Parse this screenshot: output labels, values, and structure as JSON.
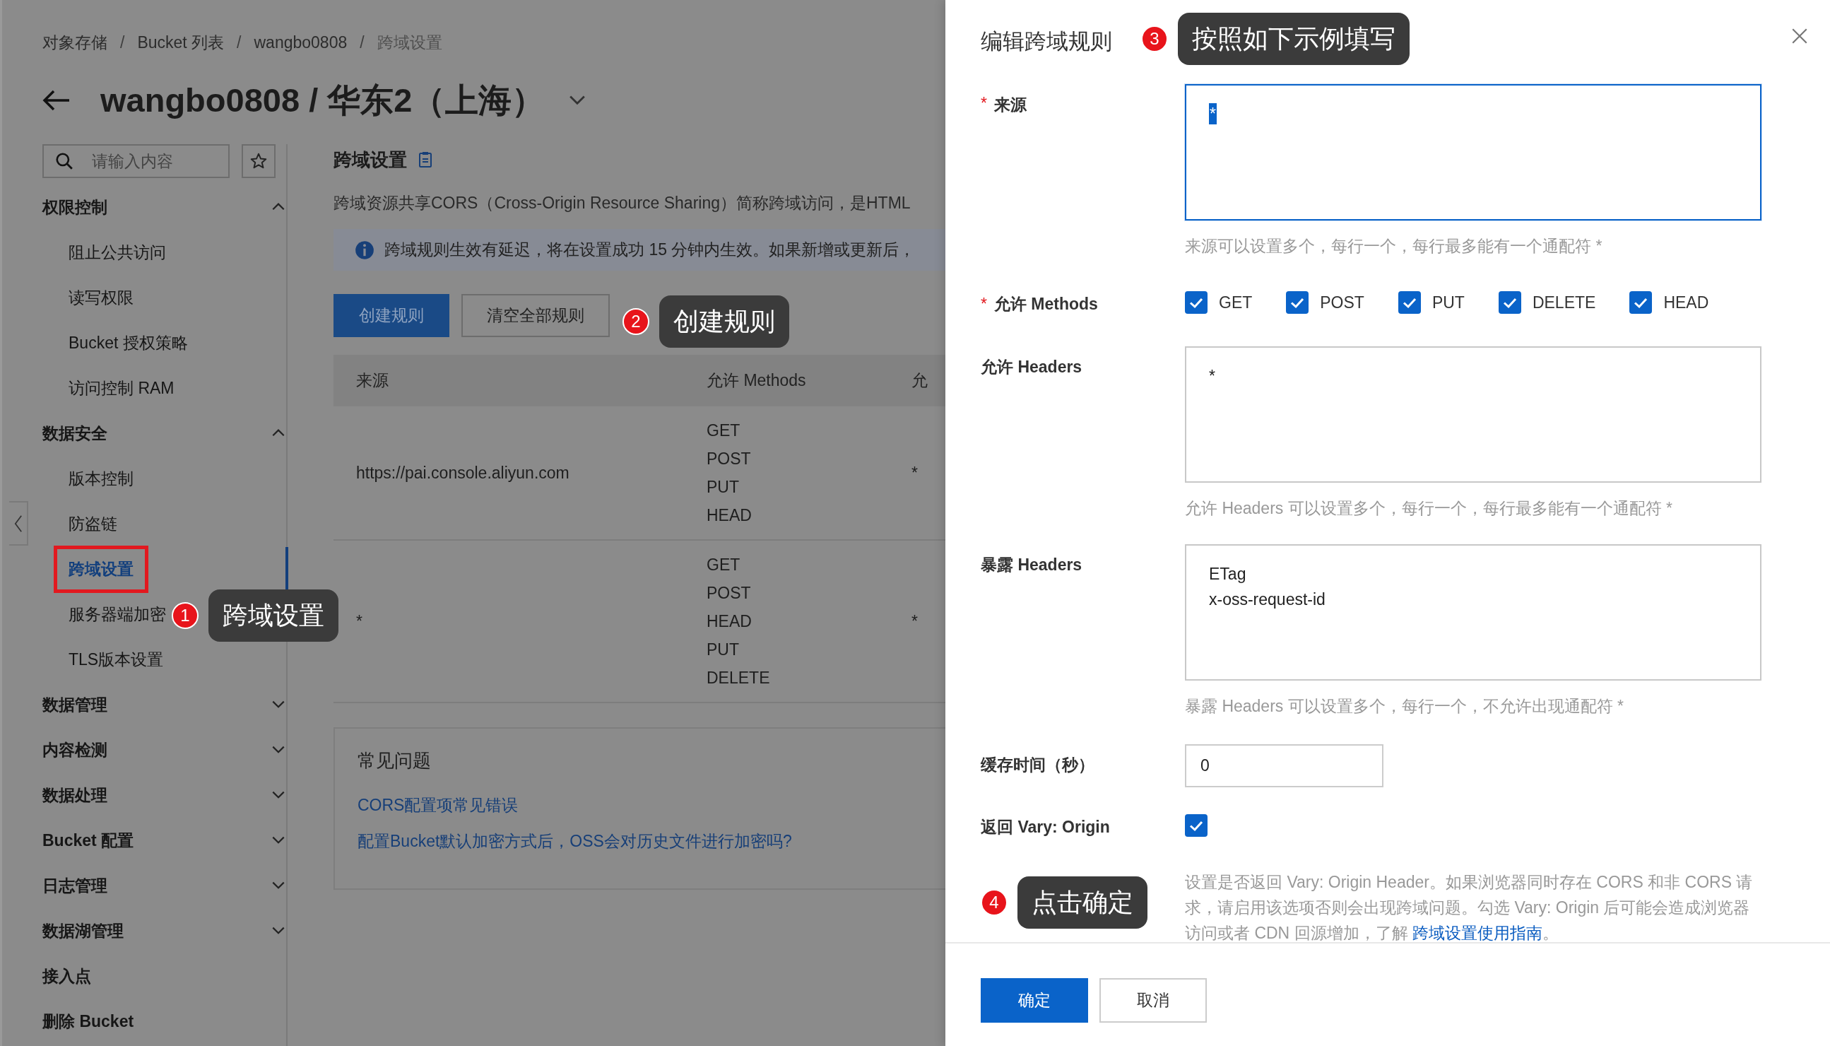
{
  "breadcrumb": {
    "separator": "/",
    "items": [
      "对象存储",
      "Bucket 列表",
      "wangbo0808",
      "跨域设置"
    ]
  },
  "page_title": "wangbo0808 / 华东2（上海）",
  "sidebar": {
    "search": {
      "placeholder": "请输入内容"
    },
    "items": [
      {
        "label": "权限控制",
        "kind": "group",
        "expanded": true,
        "children": [
          {
            "label": "阻止公共访问",
            "selected": false,
            "boxed": false
          },
          {
            "label": "读写权限",
            "selected": false,
            "boxed": false
          },
          {
            "label": "Bucket 授权策略",
            "selected": false,
            "boxed": false
          },
          {
            "label": "访问控制 RAM",
            "selected": false,
            "boxed": false
          }
        ]
      },
      {
        "label": "数据安全",
        "kind": "group",
        "expanded": true,
        "children": [
          {
            "label": "版本控制",
            "selected": false,
            "boxed": false
          },
          {
            "label": "防盗链",
            "selected": false,
            "boxed": false
          },
          {
            "label": "跨域设置",
            "selected": true,
            "boxed": true
          },
          {
            "label": "服务器端加密",
            "selected": false,
            "boxed": false
          },
          {
            "label": "TLS版本设置",
            "selected": false,
            "boxed": false
          }
        ]
      },
      {
        "label": "数据管理",
        "kind": "group",
        "expanded": false
      },
      {
        "label": "内容检测",
        "kind": "group",
        "expanded": false
      },
      {
        "label": "数据处理",
        "kind": "group",
        "expanded": false
      },
      {
        "label": "Bucket 配置",
        "kind": "group",
        "expanded": false
      },
      {
        "label": "日志管理",
        "kind": "group",
        "expanded": false
      },
      {
        "label": "数据湖管理",
        "kind": "group",
        "expanded": false
      },
      {
        "label": "接入点",
        "kind": "link"
      },
      {
        "label": "删除 Bucket",
        "kind": "link"
      }
    ]
  },
  "section": {
    "title": "跨域设置",
    "description": "跨域资源共享CORS（Cross-Origin Resource Sharing）简称跨域访问，是HTML",
    "alert": "跨域规则生效有延迟，将在设置成功 15 分钟内生效。如果新增或更新后，",
    "actions": [
      {
        "label": "创建规则",
        "kind": "primary"
      },
      {
        "label": "清空全部规则",
        "kind": "secondary"
      }
    ]
  },
  "table": {
    "columns": [
      "来源",
      "允许 Methods",
      "允"
    ],
    "rows": [
      {
        "source": "https://pai.console.aliyun.com",
        "methods": [
          "GET",
          "POST",
          "PUT",
          "HEAD"
        ],
        "column_3": "*"
      },
      {
        "source": "*",
        "methods": [
          "GET",
          "POST",
          "HEAD",
          "PUT",
          "DELETE"
        ],
        "column_3": "*"
      }
    ]
  },
  "faq": {
    "title": "常见问题",
    "links": [
      "CORS配置项常见错误",
      "配置Bucket默认加密方式后，OSS会对历史文件进行加密吗?"
    ]
  },
  "drawer": {
    "title": "编辑跨域规则",
    "fields": [
      {
        "kind": "textarea",
        "label": "来源",
        "required_mark": "*",
        "value": "*",
        "focused": true,
        "value_selected": true,
        "hint": "来源可以设置多个，每行一个，每行最多能有一个通配符 *"
      },
      {
        "kind": "checkboxes",
        "label": "允许 Methods",
        "required_mark": "*",
        "options": [
          {
            "label": "GET",
            "checked": true
          },
          {
            "label": "POST",
            "checked": true
          },
          {
            "label": "PUT",
            "checked": true
          },
          {
            "label": "DELETE",
            "checked": true
          },
          {
            "label": "HEAD",
            "checked": true
          }
        ]
      },
      {
        "kind": "textarea",
        "label": "允许 Headers",
        "value": "*",
        "focused": false,
        "value_selected": false,
        "hint": "允许 Headers 可以设置多个，每行一个，每行最多能有一个通配符 *"
      },
      {
        "kind": "textarea",
        "label": "暴露 Headers",
        "value": "ETag\nx-oss-request-id",
        "focused": false,
        "value_selected": false,
        "hint": "暴露 Headers 可以设置多个，每行一个，不允许出现通配符 *"
      },
      {
        "kind": "input",
        "label": "缓存时间（秒）",
        "value": "0"
      },
      {
        "kind": "checkbox",
        "label": "返回 Vary: Origin",
        "checked": true,
        "note": "设置是否返回 Vary: Origin Header。如果浏览器同时存在 CORS 和非 CORS 请求，请启用该选项否则会出现跨域问题。勾选 Vary: Origin 后可能会造成浏览器访问或者 CDN 回源增加，了解 ",
        "note_link": "跨域设置使用指南",
        "note_end": "。"
      }
    ],
    "buttons": [
      {
        "label": "确定",
        "kind": "primary"
      },
      {
        "label": "取消",
        "kind": "secondary"
      }
    ]
  },
  "annotations": [
    {
      "number": "1",
      "text": "跨域设置"
    },
    {
      "number": "2",
      "text": "创建规则"
    },
    {
      "number": "3",
      "text": "按照如下示例填写"
    },
    {
      "number": "4",
      "text": "点击确定"
    }
  ]
}
